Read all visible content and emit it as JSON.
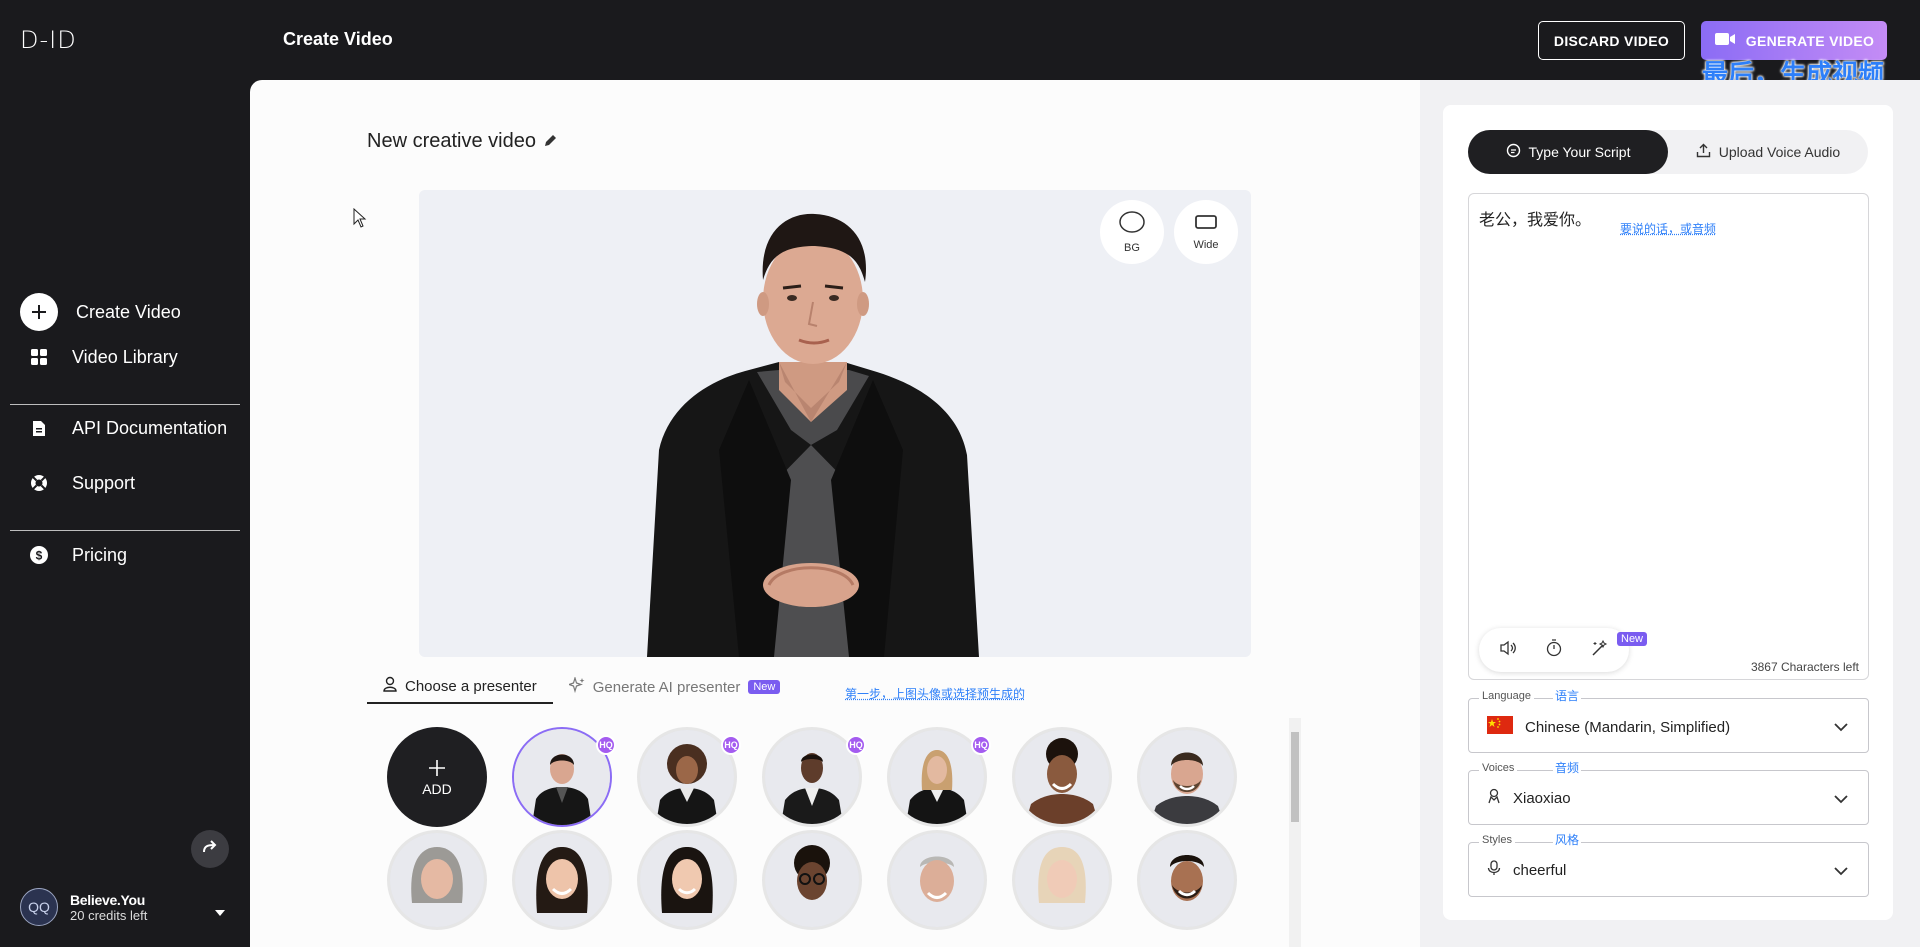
{
  "app": {
    "logo_text": "D-ID",
    "page_heading": "Create Video"
  },
  "header": {
    "discard_label": "DISCARD VIDEO",
    "generate_label": "GENERATE VIDEO",
    "annotation_final": "最后，生成视频"
  },
  "sidebar": {
    "items": [
      {
        "label": "Create Video",
        "icon": "plus-circle-icon"
      },
      {
        "label": "Video Library",
        "icon": "grid-icon"
      },
      {
        "label": "API Documentation",
        "icon": "document-icon"
      },
      {
        "label": "Support",
        "icon": "lifebuoy-icon"
      },
      {
        "label": "Pricing",
        "icon": "dollar-icon"
      }
    ],
    "user": {
      "initials": "QQ",
      "name": "Believe.You",
      "credits": "20 credits left"
    }
  },
  "editor": {
    "video_title": "New creative video",
    "stage_buttons": {
      "bg": "BG",
      "wide": "Wide"
    },
    "tabs": {
      "choose": "Choose a presenter",
      "generate": "Generate AI presenter",
      "new_badge": "New"
    },
    "annotation_step1": "第一步，上图头像或选择预生成的",
    "add_label": "ADD",
    "hq_badge": "HQ"
  },
  "script": {
    "tab_type": "Type Your Script",
    "tab_upload": "Upload Voice Audio",
    "text": "老公，我爱你。",
    "annotation": "要说的话，或音频",
    "new_badge": "New",
    "chars_left": "3867 Characters left",
    "language": {
      "label": "Language",
      "annotation": "语言",
      "value": "Chinese (Mandarin, Simplified)",
      "flag": "🇨🇳"
    },
    "voices": {
      "label": "Voices",
      "annotation": "音频",
      "value": "Xiaoxiao"
    },
    "styles": {
      "label": "Styles",
      "annotation": "风格",
      "value": "cheerful"
    }
  },
  "colors": {
    "accent": "#8b6cf5",
    "annotation_blue": "#2d7ff9",
    "dark": "#1a1a1d"
  }
}
